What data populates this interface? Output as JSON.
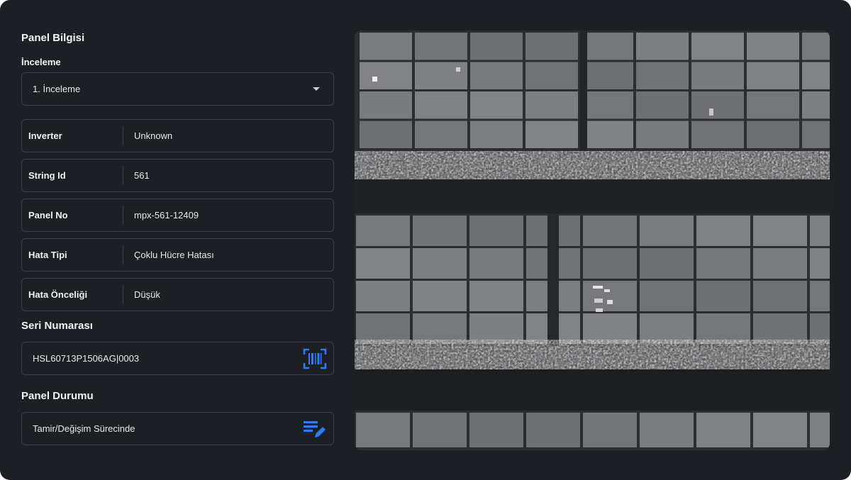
{
  "panel_info": {
    "title": "Panel Bilgisi"
  },
  "inspection": {
    "label": "İnceleme",
    "selected": "1. İnceleme"
  },
  "details": [
    {
      "key": "Inverter",
      "value": "Unknown"
    },
    {
      "key": "String Id",
      "value": "561"
    },
    {
      "key": "Panel No",
      "value": "mpx-561-12409"
    },
    {
      "key": "Hata Tipi",
      "value": "Çoklu Hücre Hatası"
    },
    {
      "key": "Hata Önceliği",
      "value": "Düşük"
    }
  ],
  "serial": {
    "label": "Seri Numarası",
    "value": "HSL60713P1506AG|0003",
    "icon": "barcode-scan-icon"
  },
  "status": {
    "label": "Panel Durumu",
    "value": "Tamir/Değişim Sürecinde",
    "icon": "edit-list-icon"
  },
  "colors": {
    "background": "#1c1f24",
    "border": "#3a3f47",
    "accent": "#2f7bf5"
  },
  "image": {
    "kind": "thermal aerial photo of solar panel rows"
  }
}
